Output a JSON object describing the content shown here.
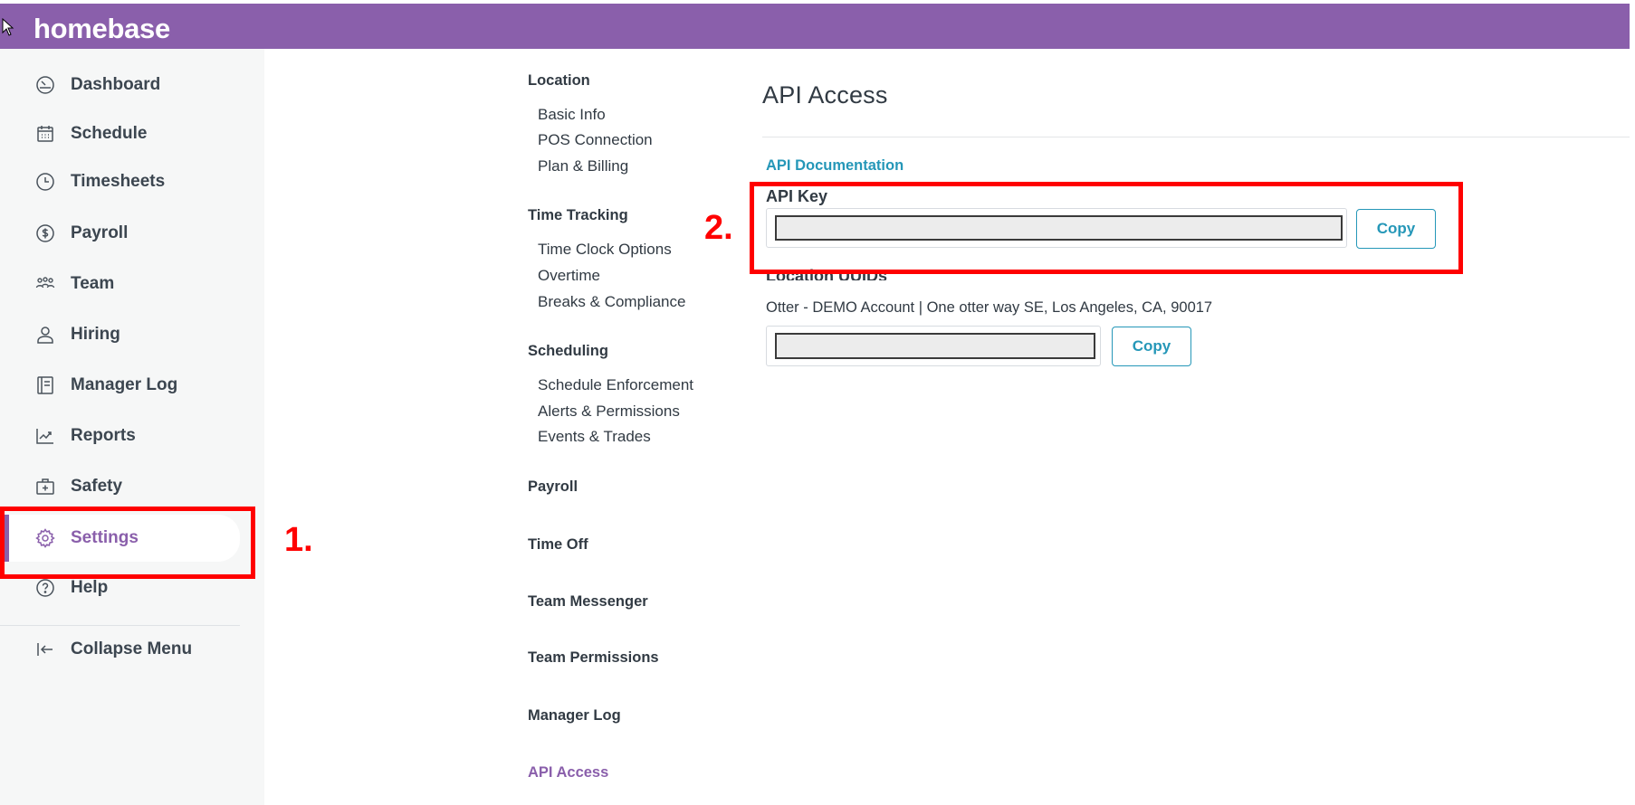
{
  "header": {
    "brand": "homebase",
    "bg_color": "#8a5fab"
  },
  "sidebar": {
    "items": [
      {
        "label": "Dashboard",
        "icon": "dashboard-gauge-icon"
      },
      {
        "label": "Schedule",
        "icon": "calendar-icon"
      },
      {
        "label": "Timesheets",
        "icon": "clock-icon"
      },
      {
        "label": "Payroll",
        "icon": "dollar-circle-icon"
      },
      {
        "label": "Team",
        "icon": "team-icon"
      },
      {
        "label": "Hiring",
        "icon": "person-icon"
      },
      {
        "label": "Manager Log",
        "icon": "notebook-icon"
      },
      {
        "label": "Reports",
        "icon": "chart-icon"
      },
      {
        "label": "Safety",
        "icon": "first-aid-icon"
      },
      {
        "label": "Settings",
        "icon": "gear-icon",
        "active": true
      },
      {
        "label": "Help",
        "icon": "help-circle-icon"
      }
    ],
    "collapse_label": "Collapse Menu",
    "active_color": "#8a5fab"
  },
  "subnav": {
    "location": {
      "title": "Location",
      "links": [
        "Basic Info",
        "POS Connection",
        "Plan & Billing"
      ]
    },
    "time_tracking": {
      "title": "Time Tracking",
      "links": [
        "Time Clock Options",
        "Overtime",
        "Breaks & Compliance"
      ]
    },
    "scheduling": {
      "title": "Scheduling",
      "links": [
        "Schedule Enforcement",
        "Alerts & Permissions",
        "Events & Trades"
      ]
    },
    "payroll": "Payroll",
    "time_off": "Time Off",
    "team_messenger": "Team Messenger",
    "team_permissions": "Team Permissions",
    "manager_log": "Manager Log",
    "api_access": "API Access"
  },
  "main": {
    "title": "API Access",
    "doc_link": "API Documentation",
    "api_key_label": "API Key",
    "api_key_value": "",
    "copy_label": "Copy",
    "uuids_label": "Location UUIDs",
    "location_text": "Otter - DEMO Account | One otter way SE, Los Angeles, CA, 90017",
    "location_uuid_value": "",
    "link_color": "#2597b8"
  },
  "annotations": {
    "step1": "1.",
    "step2": "2.",
    "color": "#ff0000"
  }
}
